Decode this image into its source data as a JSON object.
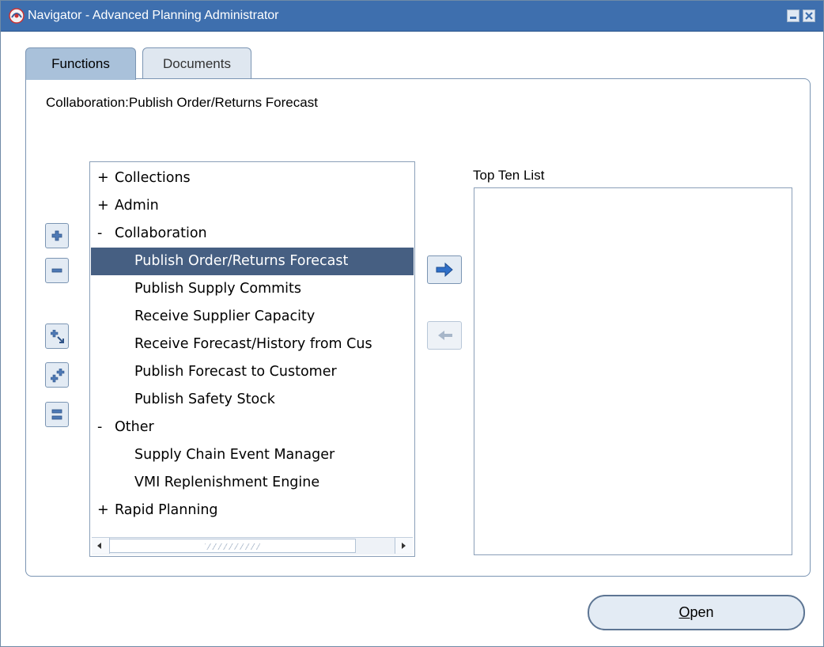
{
  "window": {
    "title": "Navigator - Advanced Planning Administrator"
  },
  "tabs": [
    {
      "label": "Functions",
      "active": true
    },
    {
      "label": "Documents",
      "active": false
    }
  ],
  "breadcrumb": "Collaboration:Publish Order/Returns Forecast",
  "tree": {
    "items": [
      {
        "mark": "+",
        "label": "Collections",
        "level": 0,
        "selected": false
      },
      {
        "mark": "+",
        "label": "Admin",
        "level": 0,
        "selected": false
      },
      {
        "mark": "-",
        "label": "Collaboration",
        "level": 0,
        "selected": false
      },
      {
        "mark": "",
        "label": "Publish Order/Returns Forecast",
        "level": 1,
        "selected": true
      },
      {
        "mark": "",
        "label": "Publish Supply Commits",
        "level": 1,
        "selected": false
      },
      {
        "mark": "",
        "label": "Receive Supplier Capacity",
        "level": 1,
        "selected": false
      },
      {
        "mark": "",
        "label": "Receive Forecast/History from Cus",
        "level": 1,
        "selected": false
      },
      {
        "mark": "",
        "label": "Publish Forecast to Customer",
        "level": 1,
        "selected": false
      },
      {
        "mark": "",
        "label": "Publish Safety Stock",
        "level": 1,
        "selected": false
      },
      {
        "mark": "-",
        "label": "Other",
        "level": 0,
        "selected": false
      },
      {
        "mark": "",
        "label": "Supply Chain Event Manager",
        "level": 1,
        "selected": false
      },
      {
        "mark": "",
        "label": "VMI Replenishment Engine",
        "level": 1,
        "selected": false
      },
      {
        "mark": "+",
        "label": "Rapid Planning",
        "level": 0,
        "selected": false
      }
    ]
  },
  "top_ten": {
    "label": "Top Ten List",
    "items": []
  },
  "open_button": {
    "mnemonic": "O",
    "rest": "pen"
  },
  "colors": {
    "titlebar": "#3e6fae",
    "selection": "#465f82",
    "active_tab": "#a9c1da"
  }
}
